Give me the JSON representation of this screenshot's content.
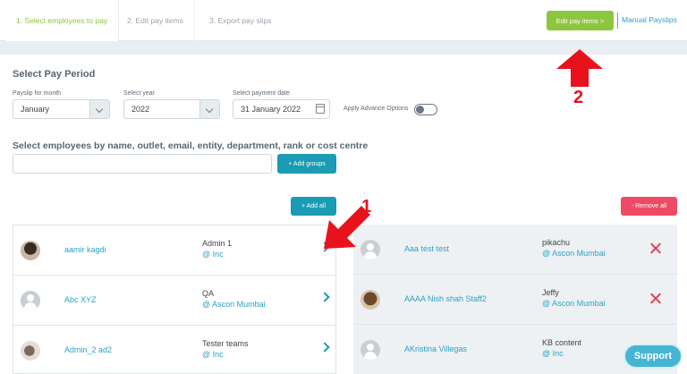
{
  "steps": [
    {
      "label": "1. Select employees to pay"
    },
    {
      "label": "2. Edit pay items"
    },
    {
      "label": "3. Export pay slips"
    }
  ],
  "topbar": {
    "edit_button": "Edit pay items >",
    "manual_link": "Manual Payslips"
  },
  "pay_period": {
    "title": "Select Pay Period",
    "month_label": "Payslip for month",
    "month_value": "January",
    "year_label": "Select year",
    "year_value": "2022",
    "date_label": "Select payment date",
    "date_value": "31 January 2022",
    "advance_label": "Apply Advance Options"
  },
  "employee_search": {
    "title": "Select employees by name, outlet, email, entity, department, rank or cost centre",
    "placeholder": "",
    "add_groups": "+ Add groups"
  },
  "actions": {
    "add_all": "+ Add all",
    "remove_all": "- Remove all"
  },
  "left_list": [
    {
      "name": "aamir kagdi",
      "group": "Admin 1",
      "entity": "@ Inc"
    },
    {
      "name": "Abc XYZ",
      "group": "QA",
      "entity": "@ Ascon Mumbai"
    },
    {
      "name": "Admin_2 ad2",
      "group": "Tester teams",
      "entity": "@ Inc"
    }
  ],
  "right_list": [
    {
      "name": "Aaa test test",
      "group": "pikachu",
      "entity": "@ Ascon Mumbai"
    },
    {
      "name": "AAAA Nish shah Staff2",
      "group": "Jeffy",
      "entity": "@ Ascon Mumbai"
    },
    {
      "name": "AKristina Villegas",
      "group": "KB content",
      "entity": "@ Inc"
    }
  ],
  "support": "Support",
  "annotations": {
    "one": "1",
    "two": "2"
  },
  "colors": {
    "accent_green": "#8cc63f",
    "teal": "#1b9bb4",
    "link_blue": "#2aa2c7",
    "danger": "#ec4b63",
    "annotation_red": "#e8121c"
  }
}
